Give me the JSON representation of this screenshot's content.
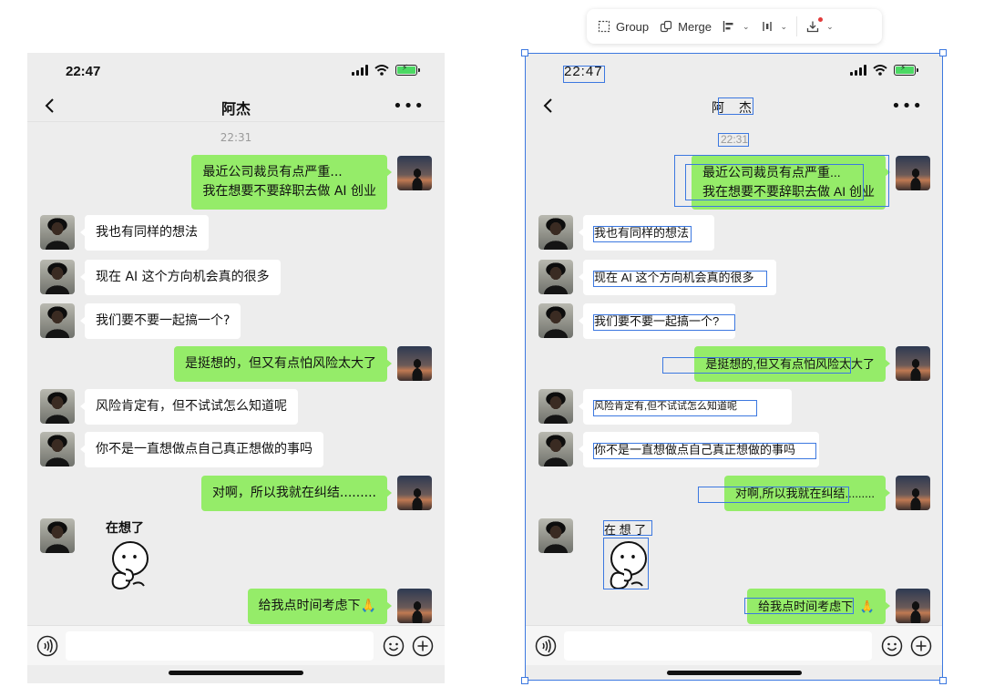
{
  "toolbar": {
    "group_label": "Group",
    "merge_label": "Merge",
    "align_chevron": "⌄",
    "distribute_chevron": "⌄",
    "export_chevron": "⌄"
  },
  "status": {
    "time": "22:47"
  },
  "chat": {
    "title": "阿杰",
    "timestamp": "22:31",
    "messages": [
      {
        "from": "me",
        "lines": [
          "最近公司裁员有点严重...",
          "我在想要不要辞职去做 AI 创业"
        ]
      },
      {
        "from": "friend",
        "lines": [
          "我也有同样的想法"
        ]
      },
      {
        "from": "friend",
        "lines": [
          "现在 AI 这个方向机会真的很多"
        ]
      },
      {
        "from": "friend",
        "lines": [
          "我们要不要一起搞一个?"
        ]
      },
      {
        "from": "me",
        "lines": [
          "是挺想的，但又有点怕风险太大了"
        ]
      },
      {
        "from": "friend",
        "lines": [
          "风险肯定有，但不试试怎么知道呢"
        ]
      },
      {
        "from": "friend",
        "lines": [
          "你不是一直想做点自己真正想做的事吗"
        ]
      },
      {
        "from": "me",
        "lines": [
          "对啊，所以我就在纠结........."
        ]
      },
      {
        "from": "friend",
        "sticker_caption": "在想了"
      },
      {
        "from": "me",
        "lines": [
          "给我点时间考虑下🙏"
        ]
      }
    ]
  },
  "right_panel": {
    "status_time": "22:47",
    "title": "阿 杰",
    "timestamp": "22:31",
    "messages": [
      [
        "最近公司裁员有点严重...",
        "我在想要不要辞职去做 AI 创业"
      ],
      [
        "我也有同样的想法"
      ],
      [
        "现在 AI 这个方向机会真的很多"
      ],
      [
        "我们要不要一起搞一个?"
      ],
      [
        "是挺想的,但又有点怕风险太大了"
      ],
      [
        "风险肯定有,但不试试怎么知道呢"
      ],
      [
        "你不是一直想做点自己真正想做的事吗"
      ],
      [
        "对啊,所以我就在纠结........."
      ],
      [
        "在 想 了"
      ],
      [
        "给我点时间考虑下",
        "🙏"
      ]
    ]
  },
  "colors": {
    "out_bubble": "#95ec69",
    "in_bubble": "#ffffff",
    "chat_bg": "#ededed",
    "selection_blue": "#3c78e0"
  },
  "icons": [
    "group-icon",
    "merge-icon",
    "align-icon",
    "distribute-icon",
    "export-icon",
    "back-icon",
    "more-icon",
    "voice-icon",
    "emoji-icon",
    "plus-icon",
    "signal-icon",
    "wifi-icon",
    "battery-icon"
  ]
}
